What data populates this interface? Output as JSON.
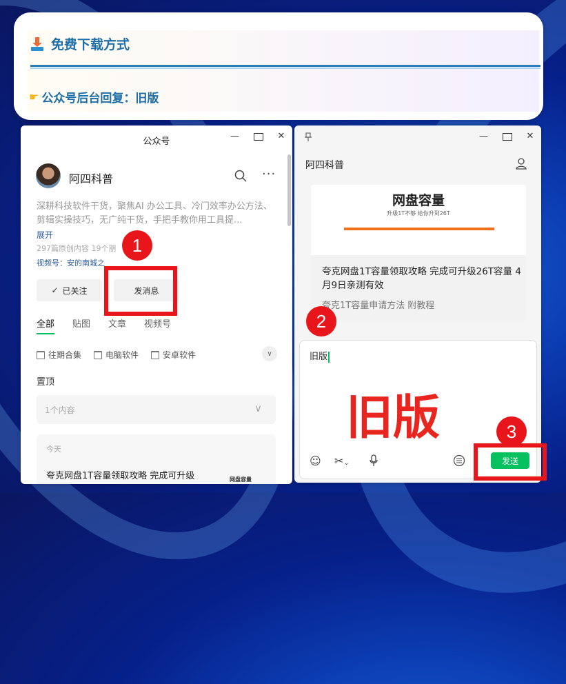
{
  "banner": {
    "title": "免费下载方式",
    "instruction": "公众号后台回复：旧版",
    "icon": "download-tray-icon",
    "pointer_icon": "pointing-hand-icon"
  },
  "left_window": {
    "title": "公众号",
    "account_name": "阿四科普",
    "description": "深耕科技软件干货，聚焦AI 办公工具、冷门效率办公方法、剪辑实操技巧，无广纯干货，手把手教你用工具提...",
    "expand_label": "展开",
    "stats": "297篇原创内容  19个朋",
    "video_account": "视频号：安的南城之",
    "follow_label": "已关注",
    "message_label": "发消息",
    "tabs": [
      "全部",
      "贴图",
      "文章",
      "视频号"
    ],
    "categories": [
      "往期合集",
      "电脑软件",
      "安卓软件"
    ],
    "pinned_label": "置顶",
    "pinned_count": "1个内容",
    "today_label": "今天",
    "article_title": "夸克网盘1T容量领取攻略 完成可升级",
    "thumb_text": "网盘容量"
  },
  "right_window": {
    "account_name": "阿四科普",
    "card": {
      "image_title": "网盘容量",
      "image_subtitle": "升级1T不够 给你升到26T",
      "title": "夸克网盘1T容量领取攻略 完成可升级26T容量 4月9日亲测有效",
      "subtitle": "夸克1T容量申请方法 附教程"
    },
    "input_text": "旧版",
    "send_label": "发送"
  },
  "overlay": {
    "big_text": "旧版",
    "steps": [
      "1",
      "2",
      "3"
    ],
    "color": "#e8151b"
  },
  "colors": {
    "accent_green": "#07c160",
    "banner_blue": "#1e6ea8"
  }
}
